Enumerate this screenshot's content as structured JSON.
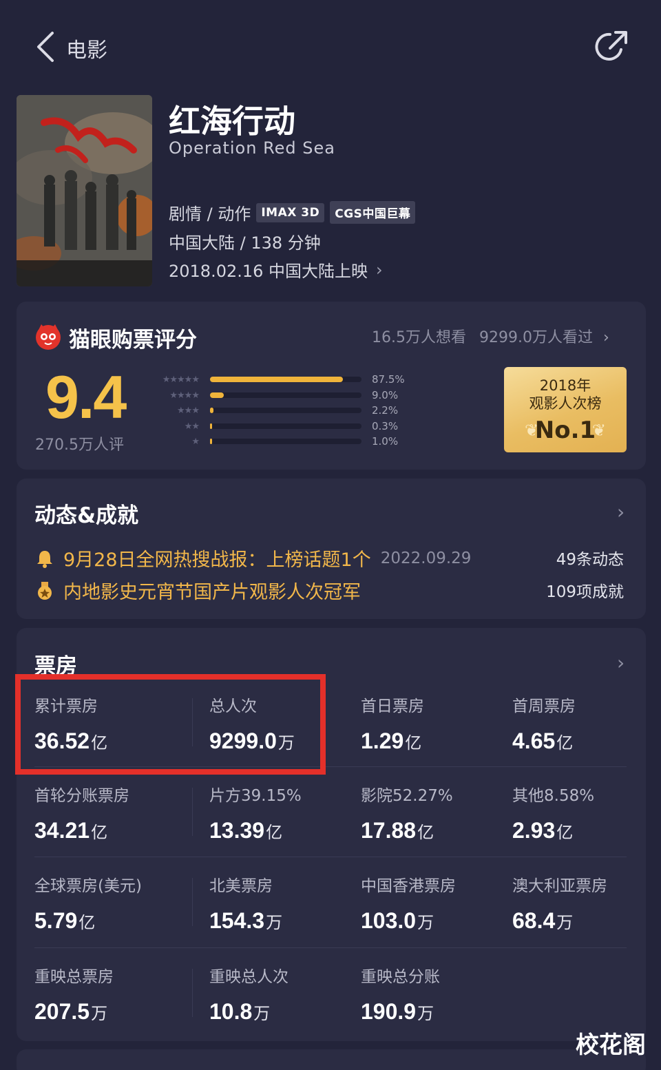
{
  "header": {
    "title": "电影"
  },
  "movie": {
    "title_cn": "红海行动",
    "title_en": "Operation Red Sea",
    "genre": "剧情 / 动作",
    "tags": [
      "IMAX 3D",
      "CGS中国巨幕"
    ],
    "region_duration": "中国大陆 / 138 分钟",
    "release": "2018.02.16 中国大陆上映"
  },
  "rating": {
    "title": "猫眼购票评分",
    "want": "16.5万人想看",
    "watched": "9299.0万人看过",
    "score": "9.4",
    "count": "270.5万人评",
    "distribution": [
      {
        "stars": "★★★★★",
        "pct": "87.5%",
        "value": 0.875
      },
      {
        "stars": "★★★★",
        "pct": "9.0%",
        "value": 0.09
      },
      {
        "stars": "★★★",
        "pct": "2.2%",
        "value": 0.022
      },
      {
        "stars": "★★",
        "pct": "0.3%",
        "value": 0.003
      },
      {
        "stars": "★",
        "pct": "1.0%",
        "value": 0.01
      }
    ],
    "badge": {
      "year": "2018年",
      "subtitle": "观影人次榜",
      "rank": "No.1"
    }
  },
  "news": {
    "title": "动态&成就",
    "items": [
      {
        "text": "9月28日全网热搜战报：上榜话题1个",
        "date": "2022.09.29",
        "icon": "bell-icon",
        "count": "49条动态"
      },
      {
        "text": "内地影史元宵节国产片观影人次冠军",
        "date": "",
        "icon": "medal-icon",
        "count": "109项成就"
      }
    ]
  },
  "boxoffice": {
    "title": "票房",
    "rows": [
      [
        {
          "label": "累计票房",
          "value": "36.52",
          "unit": "亿"
        },
        {
          "label": "总人次",
          "value": "9299.0",
          "unit": "万"
        },
        {
          "label": "首日票房",
          "value": "1.29",
          "unit": "亿"
        },
        {
          "label": "首周票房",
          "value": "4.65",
          "unit": "亿"
        }
      ],
      [
        {
          "label": "首轮分账票房",
          "value": "34.21",
          "unit": "亿"
        },
        {
          "label": "片方39.15%",
          "value": "13.39",
          "unit": "亿"
        },
        {
          "label": "影院52.27%",
          "value": "17.88",
          "unit": "亿"
        },
        {
          "label": "其他8.58%",
          "value": "2.93",
          "unit": "亿"
        }
      ],
      [
        {
          "label": "全球票房(美元)",
          "value": "5.79",
          "unit": "亿"
        },
        {
          "label": "北美票房",
          "value": "154.3",
          "unit": "万"
        },
        {
          "label": "中国香港票房",
          "value": "103.0",
          "unit": "万"
        },
        {
          "label": "澳大利亚票房",
          "value": "68.4",
          "unit": "万"
        }
      ],
      [
        {
          "label": "重映总票房",
          "value": "207.5",
          "unit": "万"
        },
        {
          "label": "重映总人次",
          "value": "10.8",
          "unit": "万"
        },
        {
          "label": "重映总分账",
          "value": "190.9",
          "unit": "万"
        }
      ]
    ]
  },
  "watermark": "校花阁",
  "colors": {
    "accent": "#f5c24a",
    "highlight": "#e4302a",
    "background": "#23243a",
    "card": "#2b2c43"
  }
}
